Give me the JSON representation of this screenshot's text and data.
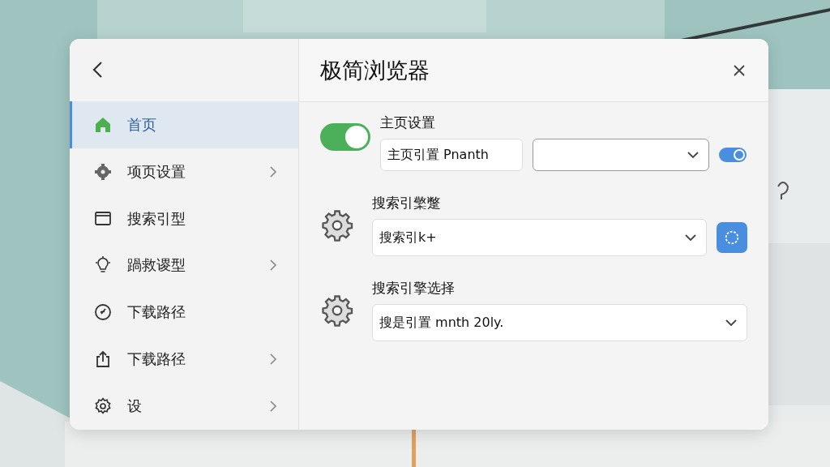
{
  "window": {
    "title": "极简浏览器"
  },
  "sidebar": {
    "items": [
      {
        "label": "首页",
        "selected": true,
        "has_submenu": false
      },
      {
        "label": "项页设置",
        "selected": false,
        "has_submenu": true
      },
      {
        "label": "搜索引型",
        "selected": false,
        "has_submenu": false
      },
      {
        "label": "踻救谡型",
        "selected": false,
        "has_submenu": true
      },
      {
        "label": "下载路径",
        "selected": false,
        "has_submenu": false
      },
      {
        "label": "下载路径",
        "selected": false,
        "has_submenu": true
      },
      {
        "label": "设",
        "selected": false,
        "has_submenu": true
      }
    ]
  },
  "sections": [
    {
      "kind": "homepage",
      "title": "主页设置",
      "toggle": {
        "on": true
      },
      "field": {
        "value": "主页引置 Pnanth"
      },
      "small_toggle": {
        "on": true
      }
    },
    {
      "kind": "select",
      "title": "搜索引檠蹩",
      "dropdown": {
        "value": "搜索引k+"
      },
      "has_action_button": true
    },
    {
      "kind": "select",
      "title": "搜索引擎选择",
      "dropdown": {
        "value": "搜是引置 mnth 20ly."
      },
      "has_action_button": false
    }
  ]
}
